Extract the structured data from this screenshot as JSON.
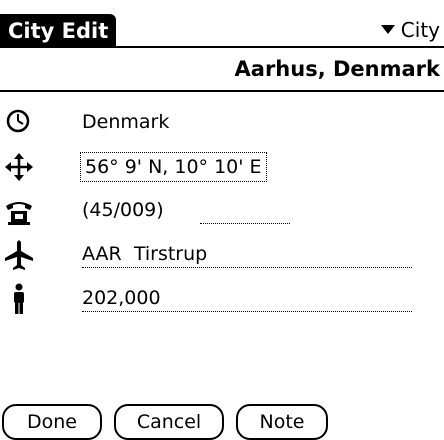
{
  "title": "City Edit",
  "category": "City",
  "city_name": "Aarhus, Denmark",
  "fields": {
    "country": "Denmark",
    "coordinates": "56° 9' N, 10° 10' E",
    "phone_code": "(45/009)",
    "phone_extra": "",
    "airport_code": "AAR",
    "airport_name": "Tirstrup",
    "population": "202,000"
  },
  "icons": {
    "clock": "clock-icon",
    "crosshair": "move-arrows-icon",
    "phone": "telephone-icon",
    "airplane": "airplane-icon",
    "person": "person-icon"
  },
  "buttons": {
    "done": "Done",
    "cancel": "Cancel",
    "note": "Note"
  }
}
